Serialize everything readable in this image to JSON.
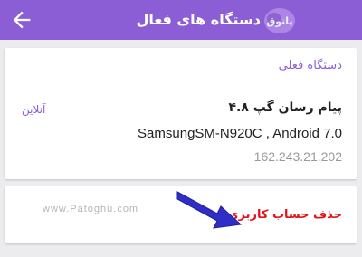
{
  "appbar": {
    "title": "دستگاه های فعال",
    "background": "#8c5ed6",
    "back_icon": "arrow-left-icon",
    "logo_text": "پاتوق"
  },
  "current_device": {
    "section_title": "دستگاه فعلی",
    "app_name": "پیام رسان گپ ۴.۸",
    "status": "آنلاین",
    "model": "SamsungSM-N920C , Android 7.0",
    "ip": "162.243.21.202"
  },
  "actions": {
    "delete_account": "حذف حساب کاربری",
    "delete_color": "#e3141c"
  },
  "watermark": "www.Patoghu.com",
  "annotation": {
    "icon": "arrow-pointer-icon",
    "color": "#2f2fc8"
  }
}
